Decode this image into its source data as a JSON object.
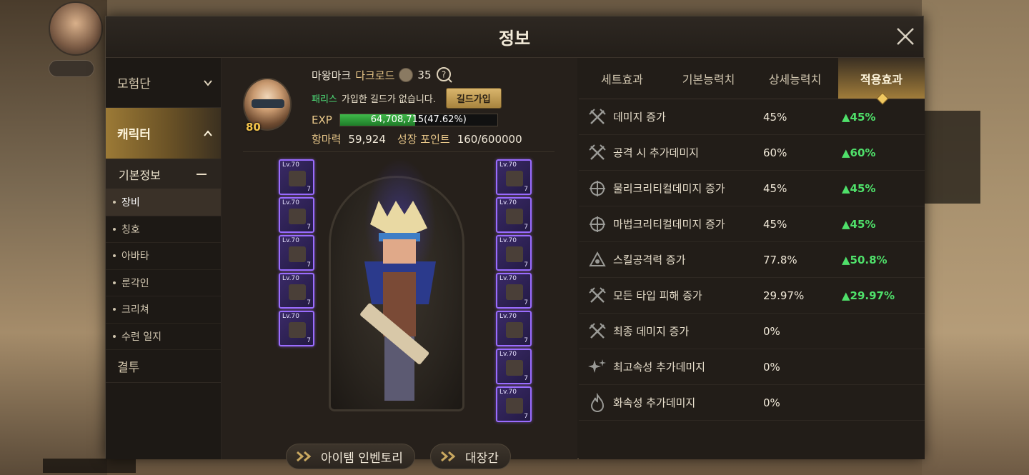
{
  "window": {
    "title": "정보"
  },
  "sidebar": {
    "categories": [
      {
        "label": "모험단"
      },
      {
        "label": "캐릭터"
      },
      {
        "label": "결투"
      }
    ],
    "sub_header": "기본정보",
    "items": [
      {
        "label": "장비"
      },
      {
        "label": "칭호"
      },
      {
        "label": "아바타"
      },
      {
        "label": "룬각인"
      },
      {
        "label": "크리쳐"
      },
      {
        "label": "수련 일지"
      }
    ]
  },
  "character": {
    "portrait_level": "80",
    "name": "마왕마크",
    "class": "다크로드",
    "level": "35",
    "server": "패리스",
    "guild_text": "가입한 길드가 없습니다.",
    "guild_button": "길드가입",
    "exp_label": "EXP",
    "exp_text": "64,708,715(47.62%)",
    "exp_percent": 47.62,
    "power_label": "항마력",
    "power_value": "59,924",
    "growth_label": "성장 포인트",
    "growth_value": "160/600000"
  },
  "equipment": {
    "level_tag": "Lv.70",
    "count_tag": "7",
    "left_slots": 5,
    "right_slots": 7
  },
  "buttons": {
    "inventory": "아이템 인벤토리",
    "forge": "대장간"
  },
  "tabs": [
    {
      "label": "세트효과"
    },
    {
      "label": "기본능력치"
    },
    {
      "label": "상세능력치"
    },
    {
      "label": "적용효과"
    }
  ],
  "effects": [
    {
      "icon": "swords-icon",
      "name": "데미지 증가",
      "value": "45%",
      "delta": "▲45%"
    },
    {
      "icon": "swords-icon",
      "name": "공격 시 추가데미지",
      "value": "60%",
      "delta": "▲60%"
    },
    {
      "icon": "crosshair-icon",
      "name": "물리크리티컬데미지 증가",
      "value": "45%",
      "delta": "▲45%"
    },
    {
      "icon": "crosshair-icon",
      "name": "마법크리티컬데미지 증가",
      "value": "45%",
      "delta": "▲45%"
    },
    {
      "icon": "skill-icon",
      "name": "스킬공격력 증가",
      "value": "77.8%",
      "delta": "▲50.8%"
    },
    {
      "icon": "swords-icon",
      "name": "모든 타입 피해 증가",
      "value": "29.97%",
      "delta": "▲29.97%"
    },
    {
      "icon": "swords-icon",
      "name": "최종 데미지 증가",
      "value": "0%",
      "delta": ""
    },
    {
      "icon": "sparkle-icon",
      "name": "최고속성 추가데미지",
      "value": "0%",
      "delta": ""
    },
    {
      "icon": "fire-icon",
      "name": "화속성 추가데미지",
      "value": "0%",
      "delta": ""
    }
  ],
  "colors": {
    "accent_gold": "#a07c3a",
    "delta_green": "#4fe06a",
    "slot_purple": "#9a6cff"
  }
}
